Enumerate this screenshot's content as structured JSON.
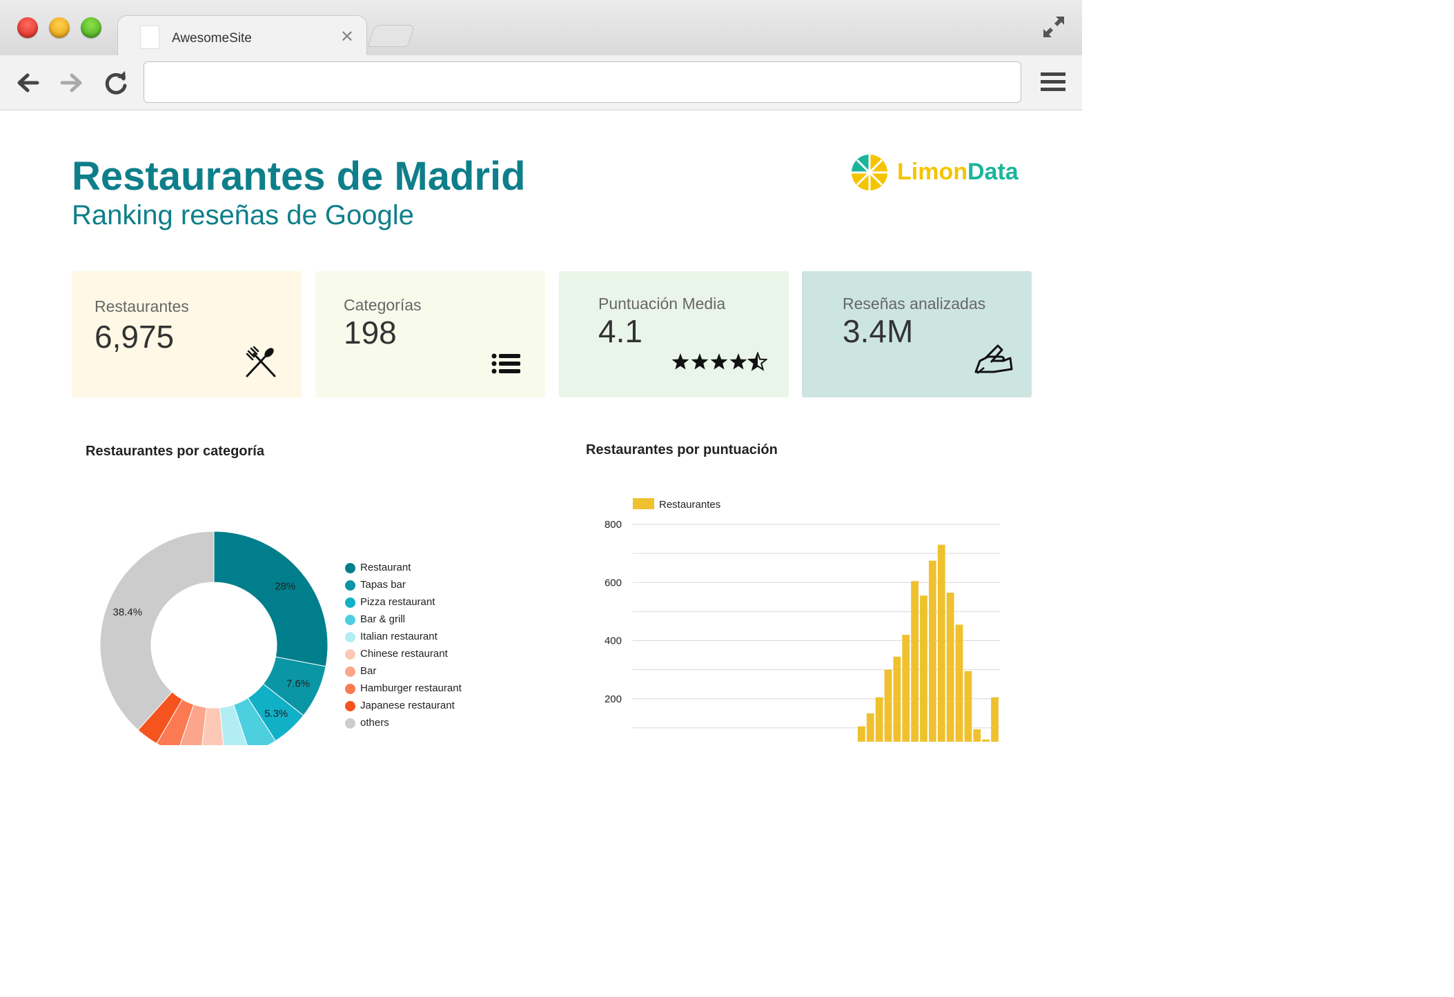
{
  "browser": {
    "tab_title": "AwesomeSite",
    "tab_close": "✕",
    "url": ""
  },
  "header": {
    "title": "Restaurantes de Madrid",
    "subtitle": "Ranking reseñas de Google",
    "logo_text_1": "Limon",
    "logo_text_2": "Data"
  },
  "kpis": [
    {
      "label": "Restaurantes",
      "value": "6,975",
      "icon": "fork-knife-icon",
      "bg": "#fff8e6"
    },
    {
      "label": "Categorías",
      "value": "198",
      "icon": "list-icon",
      "bg": "#f8faec"
    },
    {
      "label": "Puntuación Media",
      "value": "4.1",
      "icon": "stars-icon",
      "bg": "#eaf5e9"
    },
    {
      "label": "Reseñas analizadas",
      "value": "3.4M",
      "icon": "writing-hand-icon",
      "bg": "#cde5e0"
    }
  ],
  "colors": {
    "accent": "#0e7f8a",
    "logo_green": "#1bb59a",
    "logo_yellow": "#f5c400",
    "bar": "#efc12f"
  },
  "chart_data": [
    {
      "type": "pie",
      "title": "Restaurantes por categoría",
      "slices": [
        {
          "name": "Restaurant",
          "value": 28.0,
          "label": "28%",
          "color": "#007e8c"
        },
        {
          "name": "Tapas bar",
          "value": 7.6,
          "label": "7.6%",
          "color": "#0b96a6"
        },
        {
          "name": "Pizza restaurant",
          "value": 5.3,
          "label": "5.3%",
          "color": "#10b0c7"
        },
        {
          "name": "Bar & grill",
          "value": 4.0,
          "label": "",
          "color": "#4ecfe0"
        },
        {
          "name": "Italian restaurant",
          "value": 3.6,
          "label": "",
          "color": "#b3edf4"
        },
        {
          "name": "Chinese restaurant",
          "value": 3.4,
          "label": "",
          "color": "#fcc9b6"
        },
        {
          "name": "Bar",
          "value": 3.3,
          "label": "",
          "color": "#fba58a"
        },
        {
          "name": "Hamburger restaurant",
          "value": 3.2,
          "label": "",
          "color": "#fb7a52"
        },
        {
          "name": "Japanese restaurant",
          "value": 3.2,
          "label": "",
          "color": "#f5541e"
        },
        {
          "name": "others",
          "value": 38.4,
          "label": "38.4%",
          "color": "#cccccc"
        }
      ]
    },
    {
      "type": "bar",
      "title": "Restaurantes por puntuación",
      "legend": "Restaurantes",
      "ylim": [
        0,
        800
      ],
      "yticks": [
        "800",
        "600",
        "400",
        "200"
      ],
      "ytick_values": [
        800,
        600,
        400,
        200
      ],
      "values": [
        0,
        0,
        0,
        0,
        0,
        0,
        0,
        0,
        0,
        0,
        0,
        0,
        0,
        0,
        0,
        0,
        0,
        0,
        0,
        25,
        0,
        0,
        0,
        30,
        40,
        105,
        150,
        205,
        300,
        345,
        420,
        605,
        555,
        675,
        730,
        565,
        455,
        295,
        95,
        60,
        205
      ]
    }
  ]
}
